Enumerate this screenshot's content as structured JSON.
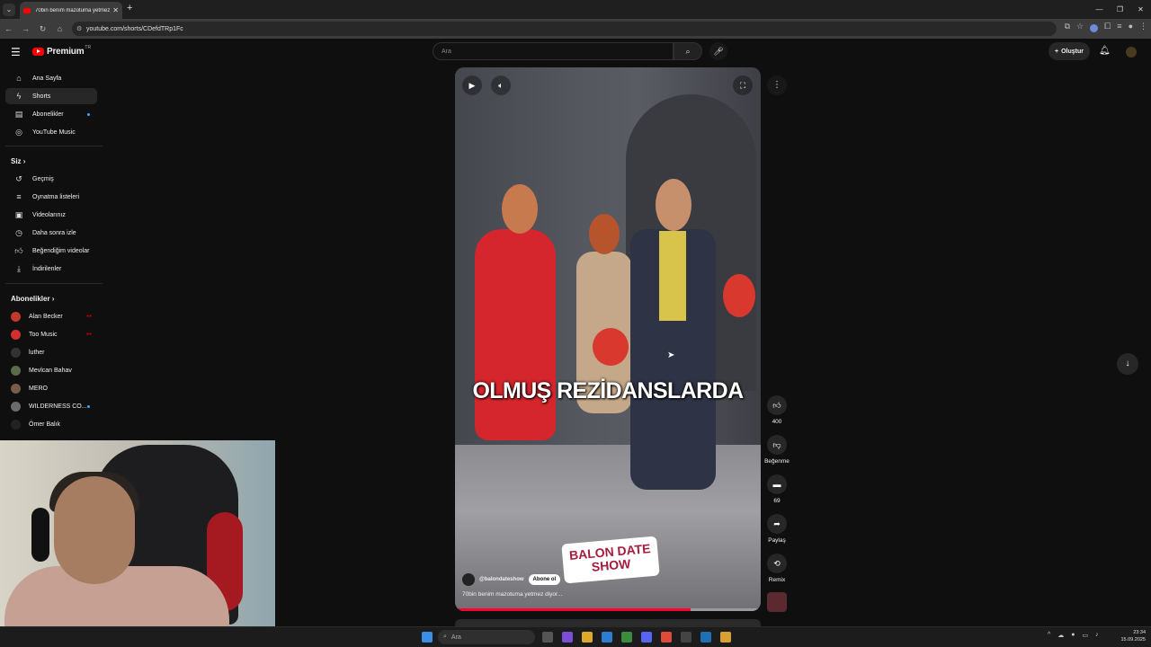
{
  "browser": {
    "tab_title": "70bin benim mazotuma yetmez",
    "url": "youtube.com/shorts/CDefdTRp1Fc"
  },
  "header": {
    "logo_text": "Premium",
    "logo_sup": "TR",
    "search_placeholder": "Ara",
    "create_label": "Oluştur"
  },
  "sidebar": {
    "main": [
      {
        "label": "Ana Sayfa",
        "icon": "home-icon"
      },
      {
        "label": "Shorts",
        "icon": "shorts-icon"
      },
      {
        "label": "Abonelikler",
        "icon": "subscriptions-icon"
      },
      {
        "label": "YouTube Music",
        "icon": "music-icon"
      }
    ],
    "you_heading": "Siz",
    "you": [
      {
        "label": "Geçmiş",
        "icon": "history-icon"
      },
      {
        "label": "Oynatma listeleri",
        "icon": "playlist-icon"
      },
      {
        "label": "Videolarınız",
        "icon": "your-videos-icon"
      },
      {
        "label": "Daha sonra izle",
        "icon": "watch-later-icon"
      },
      {
        "label": "Beğendiğim videolar",
        "icon": "liked-icon"
      },
      {
        "label": "İndirilenler",
        "icon": "download-icon"
      }
    ],
    "subs_heading": "Abonelikler",
    "subs": [
      {
        "label": "Alan Becker",
        "color": "#c0392b",
        "live": true
      },
      {
        "label": "Too Music",
        "color": "#d32f2f",
        "live": true
      },
      {
        "label": "luther",
        "color": "#333333"
      },
      {
        "label": "Mevlcan Bahav",
        "color": "#5a6b4a"
      },
      {
        "label": "MERO",
        "color": "#7a5a4a"
      },
      {
        "label": "WILDERNESS CO...",
        "color": "#6b6b6b",
        "dot": true
      },
      {
        "label": "Ömer Balık",
        "color": "#222222"
      }
    ]
  },
  "video": {
    "caption": "OLMUŞ REZİDANSLARDA",
    "brand_line1": "BALON DATE",
    "brand_line2": "SHOW",
    "channel": "@balondateshow",
    "subscribe_label": "Abone ol",
    "title": "70bin benim mazotuma yetmez diyor...",
    "progress": 0.77
  },
  "actions": {
    "likes": "400",
    "dislike_label": "Beğenme",
    "comments": "69",
    "share_label": "Paylaş",
    "remix_label": "Remix"
  },
  "taskbar": {
    "search_placeholder": "Ara",
    "time": "23:34",
    "date": "15.09.2025"
  }
}
